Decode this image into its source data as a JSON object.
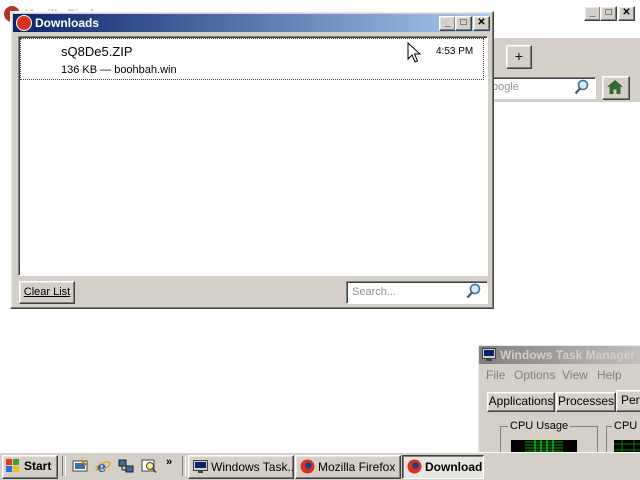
{
  "firefox": {
    "title": "Mozilla Firefox",
    "search_placeholder": "oogle",
    "newtab_label": "+"
  },
  "downloads": {
    "title": "Downloads",
    "item": {
      "filename": "sQ8De5.ZIP",
      "info": "136 KB — boohbah.win",
      "time": "4:53 PM"
    },
    "clear_label": "Clear List",
    "search_placeholder": "Search..."
  },
  "task_manager": {
    "title": "Windows Task Manager",
    "menu": [
      "File",
      "Options",
      "View",
      "Help"
    ],
    "tabs": [
      "Applications",
      "Processes",
      "Perf"
    ],
    "cpu_usage_label": "CPU Usage",
    "cpu_history_label": "CPU U"
  },
  "taskbar": {
    "start_label": "Start",
    "more_label": "»",
    "tasks": [
      {
        "label": "Windows Task...",
        "icon": "task-manager-icon"
      },
      {
        "label": "Mozilla Firefox",
        "icon": "firefox-icon"
      },
      {
        "label": "Download",
        "icon": "firefox-icon"
      }
    ],
    "quick_launch": [
      "show-desktop-icon",
      "internet-explorer-icon",
      "network-icon",
      "search-icon"
    ]
  },
  "colors": {
    "active_title_start": "#0a246a",
    "active_title_end": "#a6caf0",
    "inactive_title": "#808080",
    "face": "#d4d0c8",
    "firefox_red": "#d6321f"
  }
}
